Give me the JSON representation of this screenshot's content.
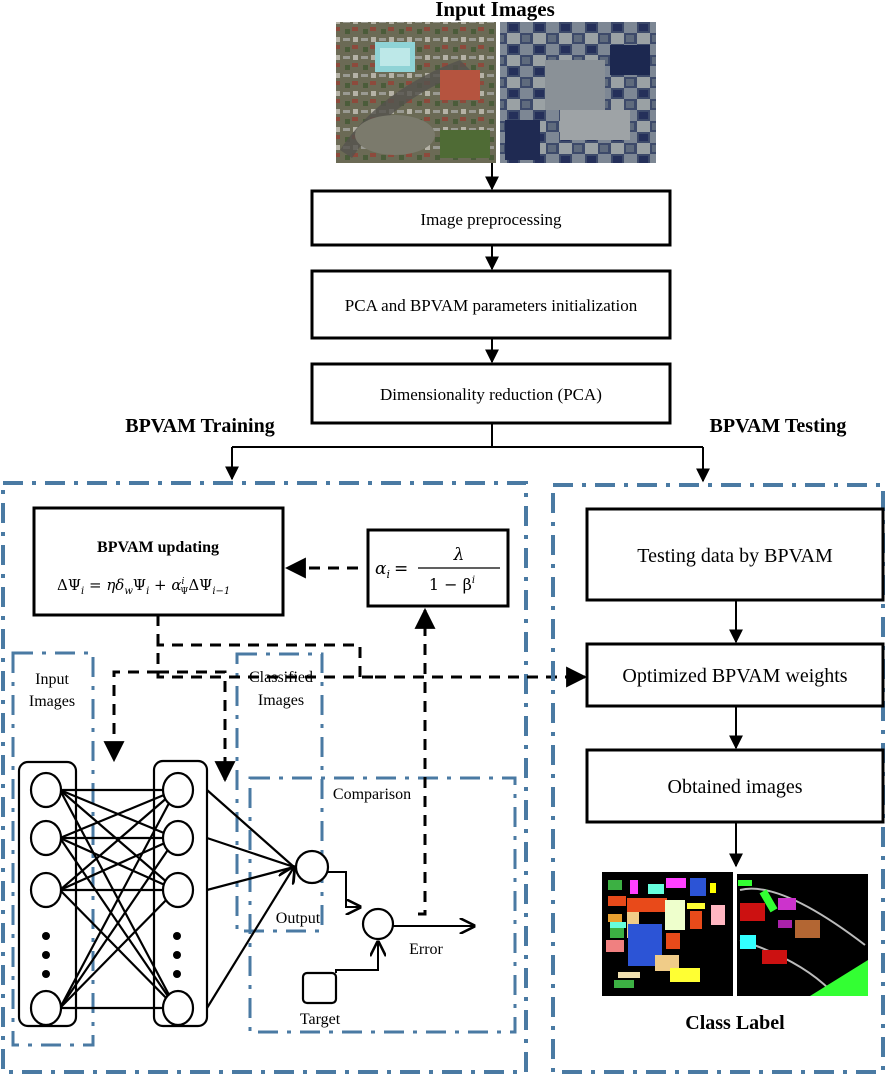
{
  "header": {
    "title": "Input Images",
    "input_images": [
      {
        "name": "urban-scene",
        "description": "satellite image of urban area (Pavia University)"
      },
      {
        "name": "agricultural-scene",
        "description": "satellite image of agricultural fields (Indian Pines)"
      }
    ]
  },
  "pipeline": {
    "steps": [
      {
        "label": "Image preprocessing"
      },
      {
        "label": "PCA and BPVAM parameters initialization"
      },
      {
        "label": "Dimensionality reduction (PCA)"
      }
    ]
  },
  "training": {
    "title": "BPVAM Training",
    "update_box": {
      "title": "BPVAM updating",
      "formula": "ΔΨᵢ = ηδ_w Ψᵢ + α^i_Ψ ΔΨᵢ₋₁",
      "formula_parts": {
        "lhs": "ΔΨ",
        "lhs_sub": "i",
        "eq": " = ηδ",
        "delta_sub": "w",
        "psi": "Ψ",
        "psi_sub": "i",
        "plus": " + α",
        "alpha_sup": "i",
        "alpha_sub": "Ψ",
        "tail": "ΔΨ",
        "tail_sub": "i−1"
      }
    },
    "alpha_box": {
      "formula": "αᵢ = λ / (1 − βⁱ)",
      "lhs": "α",
      "lhs_sub": "i",
      "eq": "=",
      "numerator": "λ",
      "denominator": "1 − β",
      "den_sup": "i"
    },
    "sub_panels": {
      "input_images_line1": "Input",
      "input_images_line2": "Images",
      "classified_line1": "Classified",
      "classified_line2": "Images",
      "comparison": "Comparison"
    },
    "network": {
      "input_layer_nodes": 4,
      "hidden_layer_nodes": 4,
      "ellipsis": "⋮"
    },
    "labels": {
      "output": "Output",
      "error": "Error",
      "target": "Target"
    }
  },
  "testing": {
    "title": "BPVAM Testing",
    "steps": [
      {
        "label": "Testing data by BPVAM"
      },
      {
        "label": "Optimized BPVAM weights"
      },
      {
        "label": "Obtained images"
      }
    ],
    "output_caption": "Class Label",
    "output_images": [
      {
        "name": "indian-pines-class-map"
      },
      {
        "name": "pavia-university-class-map"
      }
    ]
  },
  "colors": {
    "panel_border": "#4a7aa3",
    "line": "#000000",
    "background": "#ffffff"
  }
}
